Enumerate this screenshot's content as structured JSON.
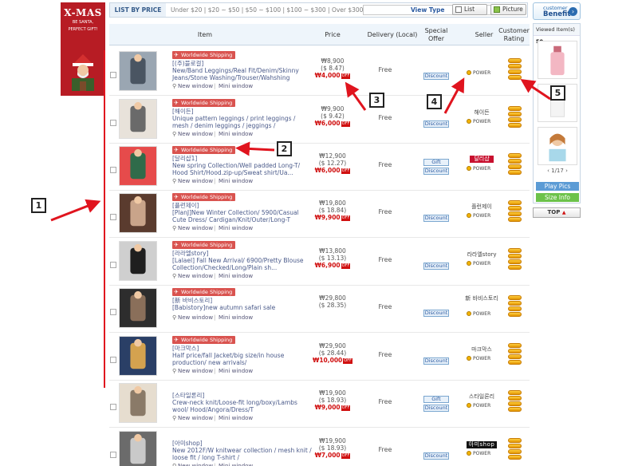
{
  "banner": {
    "line1": "X-MAS",
    "line2": "BE SANTA,",
    "line3": "PERFECT GIFT!"
  },
  "filter": {
    "label": "LIST BY PRICE",
    "ranges": "Under $20  |  $20 ~ $50  |  $50 ~ $100  |  $100 ~ $300  |  Over $300",
    "view_type": "View Type",
    "list_label": "List",
    "picture_label": "Picture"
  },
  "benefit": {
    "line1": "customer",
    "line2": "Benefit"
  },
  "headers": {
    "item": "Item",
    "price": "Price",
    "delivery": "Delivery (Local)",
    "special_offer": "Special Offer",
    "seller": "Seller",
    "rating": "Customer Rating"
  },
  "ship_label": "Worldwide Shipping",
  "new_window": "New window",
  "mini_window": "Mini window",
  "free": "Free",
  "discount": "Discount",
  "gift": "Gift",
  "power": "POWER",
  "off": "OFF",
  "rows": [
    {
      "title": "[(주)블로걸]\nNew/Band Leggings/Real Fit/Denim/Skinny Jeans/Stone Washing/Trouser/Wahshing",
      "price": "₩8,900",
      "usd": "($ 8.47)",
      "sale": "₩4,000",
      "seller": "",
      "gift": false,
      "ship": true
    },
    {
      "title": "[해이든]\nUnique pattern leggings / print leggings / mesh / denim leggings / jeggings /",
      "price": "₩9,900",
      "usd": "($ 9.42)",
      "sale": "₩6,000",
      "seller": "해이든",
      "gift": false,
      "ship": true
    },
    {
      "title": "[달리샵1]\nNew spring Collection/Well padded Long-T/ Hood Shirt/Hood.zip-up/Sweat shirt/Ua...",
      "price": "₩12,900",
      "usd": "($ 12.27)",
      "sale": "₩6,000",
      "seller": "달리샵",
      "gift": true,
      "ship": true
    },
    {
      "title": "[플런제이]\n[PlanJ]New Winter Collection/ 5900/Casual Cute Dress/ Cardigan/Knit/Outer/Long-T",
      "price": "₩19,800",
      "usd": "($ 18.84)",
      "sale": "₩9,900",
      "seller": "플런제이",
      "gift": false,
      "ship": true
    },
    {
      "title": "[라라엘story]\n[Lalael] Fall New Arrival/ 6900/Pretty Blouse Collection/Checked/Long/Plain sh...",
      "price": "₩13,800",
      "usd": "($ 13.13)",
      "sale": "₩6,900",
      "seller": "라라엘story",
      "gift": false,
      "ship": true
    },
    {
      "title": "[新 바비스토리]\n[Babistory]new autumn safari sale",
      "price": "₩29,800",
      "usd": "($ 28.35)",
      "sale": "",
      "seller": "新 바비스토리",
      "gift": false,
      "ship": true
    },
    {
      "title": "[마크막스]\nHalf price/fall Jacket/big size/in house production/ new arrivals/",
      "price": "₩29,900",
      "usd": "($ 28.44)",
      "sale": "₩10,000",
      "seller": "마크막스",
      "gift": false,
      "ship": true
    },
    {
      "title": "[스타일론리]\nCrew-neck knit/Loose-fit long/boxy/Lambs wool/ Hood/Angora/Dress/T",
      "price": "₩19,900",
      "usd": "($ 18.93)",
      "sale": "₩9,000",
      "seller": "스타일론리",
      "gift": true,
      "ship": false
    },
    {
      "title": "[아미shop]\nNew 2012F/W knitwear collection / mesh knit / loose fit / long T-shirt /",
      "price": "₩19,900",
      "usd": "($ 18.93)",
      "sale": "₩7,000",
      "seller": "아미shop",
      "gift": false,
      "ship": false
    }
  ],
  "viewed": {
    "label": "Viewed Item(s)",
    "count": "50",
    "pager": "1/17",
    "play": "Play Pics",
    "size": "Size Info"
  },
  "top_label": "TOP",
  "annotations": [
    "1",
    "2",
    "3",
    "4",
    "5"
  ],
  "colors": {
    "accent": "#2b5aa0",
    "sale_red": "#d01010",
    "ship_red": "#d9534f",
    "arrow_red": "#e0141e"
  }
}
